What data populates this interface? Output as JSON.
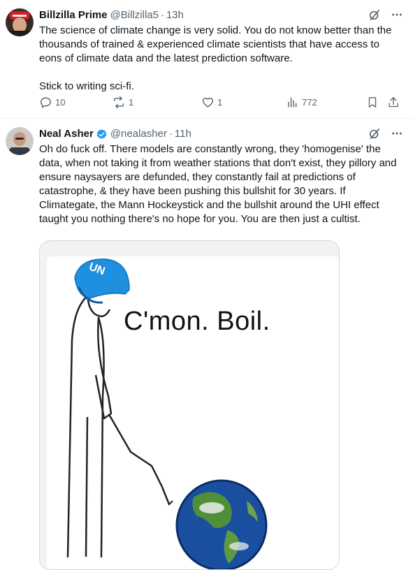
{
  "tweets": [
    {
      "display_name": "Billzilla Prime",
      "handle": "@Billzilla5",
      "separator": "·",
      "time": "13h",
      "text": "The science of climate change is very solid. You do not know better than the thousands of trained & experienced climate scientists that have access to eons of climate data and the latest prediction software.\n\nStick to writing sci-fi.",
      "replies": "10",
      "reposts": "1",
      "likes": "1",
      "views": "772",
      "verified": false
    },
    {
      "display_name": "Neal Asher",
      "handle": "@nealasher",
      "separator": "·",
      "time": "11h",
      "text": "Oh do fuck off. There models are constantly wrong, they 'homogenise' the data, when not taking it from weather stations that don't exist, they pillory and ensure naysayers are defunded, they constantly fail at predictions of catastrophe, & they have been pushing this bullshit for 30 years. If Climategate, the Mann Hockeystick and the bullshit around the UHI effect taught you nothing there's no hope for you. You are then just a cultist.",
      "verified": true,
      "media": {
        "caption": "C'mon. Boil.",
        "helmet_text": "UN"
      }
    }
  ],
  "colors": {
    "text": "#0f1419",
    "secondary": "#536471",
    "verified_blue": "#1d9bf0",
    "border": "#eff3f4",
    "helmet_blue": "#1f8fe0"
  },
  "icons": [
    "grok-icon",
    "more-icon",
    "reply-icon",
    "repost-icon",
    "like-icon",
    "views-icon",
    "bookmark-icon",
    "share-icon",
    "verified-badge-icon"
  ]
}
